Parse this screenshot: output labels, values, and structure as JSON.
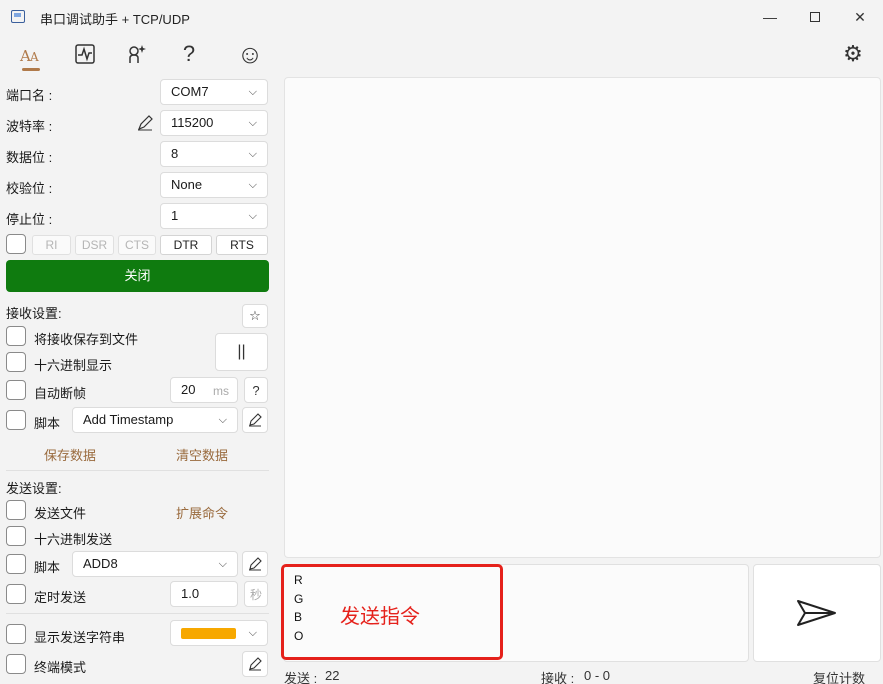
{
  "window": {
    "title": "串口调试助手 + TCP/UDP",
    "min_glyph": "—",
    "close_glyph": "✕"
  },
  "toolbar": {
    "help_glyph": "?",
    "smile_glyph": "☺",
    "settings_glyph": "⚙"
  },
  "port": {
    "name_label": "端口名 :",
    "name_value": "COM7",
    "baud_label": "波特率 :",
    "baud_value": "115200",
    "databits_label": "数据位 :",
    "databits_value": "8",
    "parity_label": "校验位 :",
    "parity_value": "None",
    "stopbits_label": "停止位 :",
    "stopbits_value": "1",
    "chevron": "⌵"
  },
  "signals": [
    "RI",
    "DSR",
    "CTS",
    "DTR",
    "RTS"
  ],
  "close_button": "关闭",
  "receive": {
    "section_label": "接收设置:",
    "star": "☆",
    "save_to_file": "将接收保存到文件",
    "hex_display": "十六进制显示",
    "pause": "||",
    "auto_frame": "自动断帧",
    "frame_value": "20",
    "frame_unit": "ms",
    "frame_help": "?",
    "script_label": "脚本",
    "script_value": "Add Timestamp",
    "save_data": "保存数据",
    "clear_data": "清空数据"
  },
  "send": {
    "section_label": "发送设置:",
    "send_file": "发送文件",
    "extend_cmd": "扩展命令",
    "hex_send": "十六进制发送",
    "script_label": "脚本",
    "script_value": "ADD8",
    "timed_send": "定时发送",
    "timed_value": "1.0",
    "timed_unit": "秒",
    "show_string": "显示发送字符串",
    "terminal_mode": "终端模式",
    "input_text": "R\nG\nB\nO",
    "annotation": "发送指令",
    "highlight_color": "#e5211b",
    "string_color": "#f7a800"
  },
  "status": {
    "sent_label": "发送 :",
    "sent_value": "22",
    "recv_label": "接收 :",
    "recv_value": "0 - 0",
    "reset": "复位计数"
  },
  "colors": {
    "accent_green": "#0f7b0f",
    "link_brown": "#9a6b3e"
  }
}
